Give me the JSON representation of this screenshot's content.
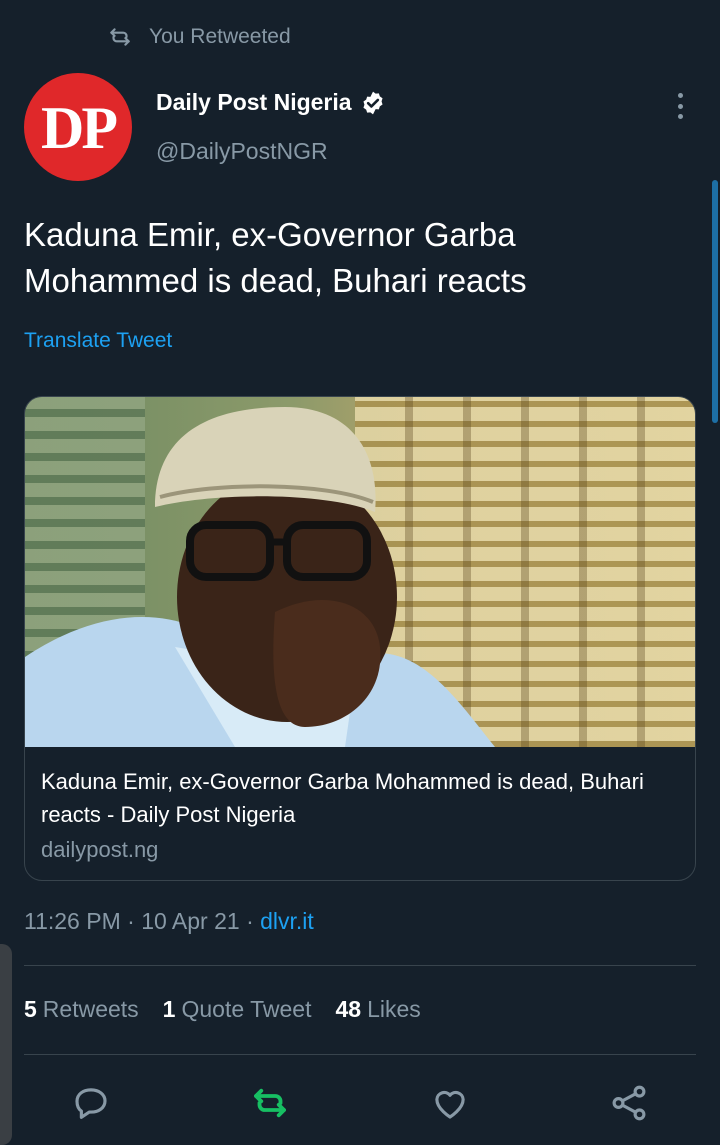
{
  "colors": {
    "background": "#15202b",
    "primary_text": "#ffffff",
    "secondary_text": "#8899a6",
    "link": "#1da1f2",
    "retweet_active": "#17bf63",
    "divider": "#38444d",
    "avatar_bg": "#e0282a"
  },
  "retweet_header": {
    "icon": "retweet-icon",
    "text": "You Retweeted"
  },
  "author": {
    "avatar_text": "DP",
    "name": "Daily Post Nigeria",
    "handle": "@DailyPostNGR",
    "verified": true
  },
  "tweet": {
    "text": "Kaduna Emir, ex-Governor Garba Mohammed is dead, Buhari reacts",
    "translate_label": "Translate Tweet"
  },
  "link_card": {
    "title": "Kaduna Emir, ex-Governor Garba Mohammed is dead, Buhari reacts - Daily Post Nigeria",
    "domain": "dailypost.ng"
  },
  "meta": {
    "time": "11:26 PM",
    "date": "10 Apr 21",
    "source": "dlvr.it"
  },
  "stats": {
    "retweets_count": "5",
    "retweets_label": "Retweets",
    "quotes_count": "1",
    "quotes_label": "Quote Tweet",
    "likes_count": "48",
    "likes_label": "Likes"
  },
  "actions": [
    "reply-icon",
    "retweet-icon",
    "like-icon",
    "share-icon"
  ]
}
